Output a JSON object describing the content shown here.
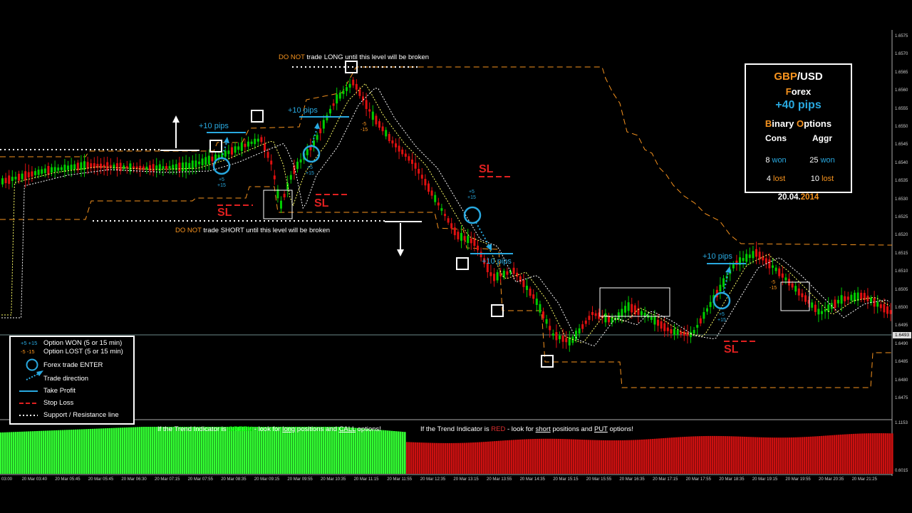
{
  "chart": {
    "annotations": {
      "long_prefix": "DO NOT",
      "long_rest": "trade LONG until this level will be broken",
      "short_prefix": "DO NOT",
      "short_rest": "trade SHORT until this level will be broken"
    },
    "sl_label": "SL",
    "pips_label": "+10 pips",
    "won_values": "+5 +15",
    "won_plus5": "+5",
    "won_plus15": "+15",
    "lost_values": "-5 -15",
    "lost_minus5": "-5",
    "lost_minus15": "-15"
  },
  "infobox": {
    "pair_base": "GBP",
    "pair_sep": "/",
    "pair_quote": "USD",
    "market_first": "F",
    "market_rest": "orex",
    "pips": "+40 pips",
    "bo_first": "B",
    "bo_rest": "inary ",
    "bo_first2": "O",
    "bo_rest2": "ptions",
    "cons_header": "Cons",
    "aggr_header": "Aggr",
    "cons_won_n": "8",
    "cons_won_w": "won",
    "cons_lost_n": "4",
    "cons_lost_w": "lost",
    "aggr_won_n": "25",
    "aggr_won_w": "won",
    "aggr_lost_n": "10",
    "aggr_lost_w": "lost",
    "date_main": "20.04.",
    "date_year": "2014"
  },
  "legend": {
    "won": "Option WON (5 or 15 min)",
    "lost": "Option LOST (5 or 15 min)",
    "enter": "Forex trade ENTER",
    "direction": "Trade direction",
    "take_profit": "Take Profit",
    "stop_loss": "Stop Loss",
    "support": "Support / Resistance line"
  },
  "trend": {
    "green_a": "If the Trend Indicator is ",
    "green_word": "GREEN",
    "green_b": " - look for ",
    "green_long": "long",
    "green_c": " positions and ",
    "green_call": "CALL",
    "green_d": " options!",
    "red_a": "If the Trend Indicator is ",
    "red_word": "RED",
    "red_b": " - look for ",
    "red_short": "short",
    "red_c": " positions and ",
    "red_put": "PUT",
    "red_d": " options!"
  },
  "price_axis": [
    "1.6575",
    "1.6570",
    "1.6565",
    "1.6560",
    "1.6555",
    "1.6550",
    "1.6545",
    "1.6540",
    "1.6535",
    "1.6530",
    "1.6525",
    "1.6520",
    "1.6515",
    "1.6510",
    "1.6505",
    "1.6500",
    "1.6495",
    "1.6490",
    "1.6485",
    "1.6480",
    "1.6475"
  ],
  "current_price": "1.6493",
  "indicator_axis": [
    "1.1153",
    "0.6015"
  ],
  "time_axis": [
    "03:00",
    "20 Mar 03:40",
    "20 Mar 05:45",
    "20 Mar 05:45",
    "20 Mar 06:30",
    "20 Mar 07:15",
    "20 Mar 07:55",
    "20 Mar 08:35",
    "20 Mar 09:15",
    "20 Mar 09:55",
    "20 Mar 10:35",
    "20 Mar 11:15",
    "20 Mar 11:55",
    "20 Mar 12:35",
    "20 Mar 13:15",
    "20 Mar 13:55",
    "20 Mar 14:35",
    "20 Mar 15:15",
    "20 Mar 15:55",
    "20 Mar 16:35",
    "20 Mar 17:15",
    "20 Mar 17:55",
    "20 Mar 18:35",
    "20 Mar 19:15",
    "20 Mar 19:55",
    "20 Mar 20:35",
    "20 Mar 21:25"
  ],
  "colors": {
    "bull": "#00cc00",
    "bear": "#e01010",
    "accent_blue": "#29a9e0",
    "accent_orange": "#f7931e",
    "support_line": "#ffffff"
  }
}
